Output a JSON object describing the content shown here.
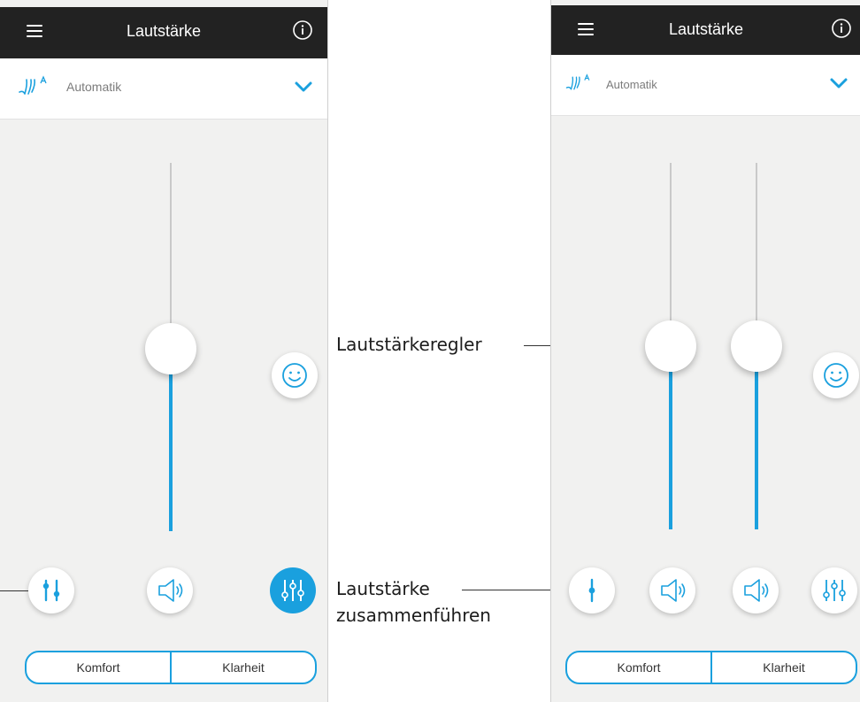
{
  "left_screen": {
    "header": {
      "title": "Lautstärke",
      "menu_icon": "hamburger-menu-icon",
      "info_icon": "info-icon"
    },
    "program": {
      "label": "Automatik",
      "icon": "hearing-program-icon",
      "expand_icon": "chevron-down-icon"
    },
    "slider_level": 0.52,
    "buttons": [
      {
        "name": "merge-volume-button",
        "icon": "split-sliders-icon",
        "active": false
      },
      {
        "name": "speaker-button",
        "icon": "speaker-icon",
        "active": false
      },
      {
        "name": "equalizer-button",
        "icon": "equalizer-icon",
        "active": true
      }
    ],
    "comfort_icon": "smiley-icon",
    "segments": [
      "Komfort",
      "Klarheit"
    ]
  },
  "right_screen": {
    "header": {
      "title": "Lautstärke",
      "menu_icon": "hamburger-menu-icon",
      "info_icon": "info-icon"
    },
    "program": {
      "label": "Automatik",
      "icon": "hearing-program-icon",
      "expand_icon": "chevron-down-icon"
    },
    "slider_levels": [
      0.52,
      0.52
    ],
    "buttons": [
      {
        "name": "merge-volume-button",
        "icon": "single-slider-icon",
        "active": false
      },
      {
        "name": "speaker-left-button",
        "icon": "speaker-icon",
        "active": false
      },
      {
        "name": "speaker-right-button",
        "icon": "speaker-icon",
        "active": false
      },
      {
        "name": "equalizer-button",
        "icon": "equalizer-icon",
        "active": false
      }
    ],
    "comfort_icon": "smiley-icon",
    "segments": [
      "Komfort",
      "Klarheit"
    ]
  },
  "callouts": {
    "volume_slider": "Lautstärkeregler",
    "merge_line1": "Lautstärke",
    "merge_line2": "zusammenführen"
  },
  "colors": {
    "accent": "#1aa0de",
    "header": "#222222",
    "background": "#f1f1f0"
  }
}
